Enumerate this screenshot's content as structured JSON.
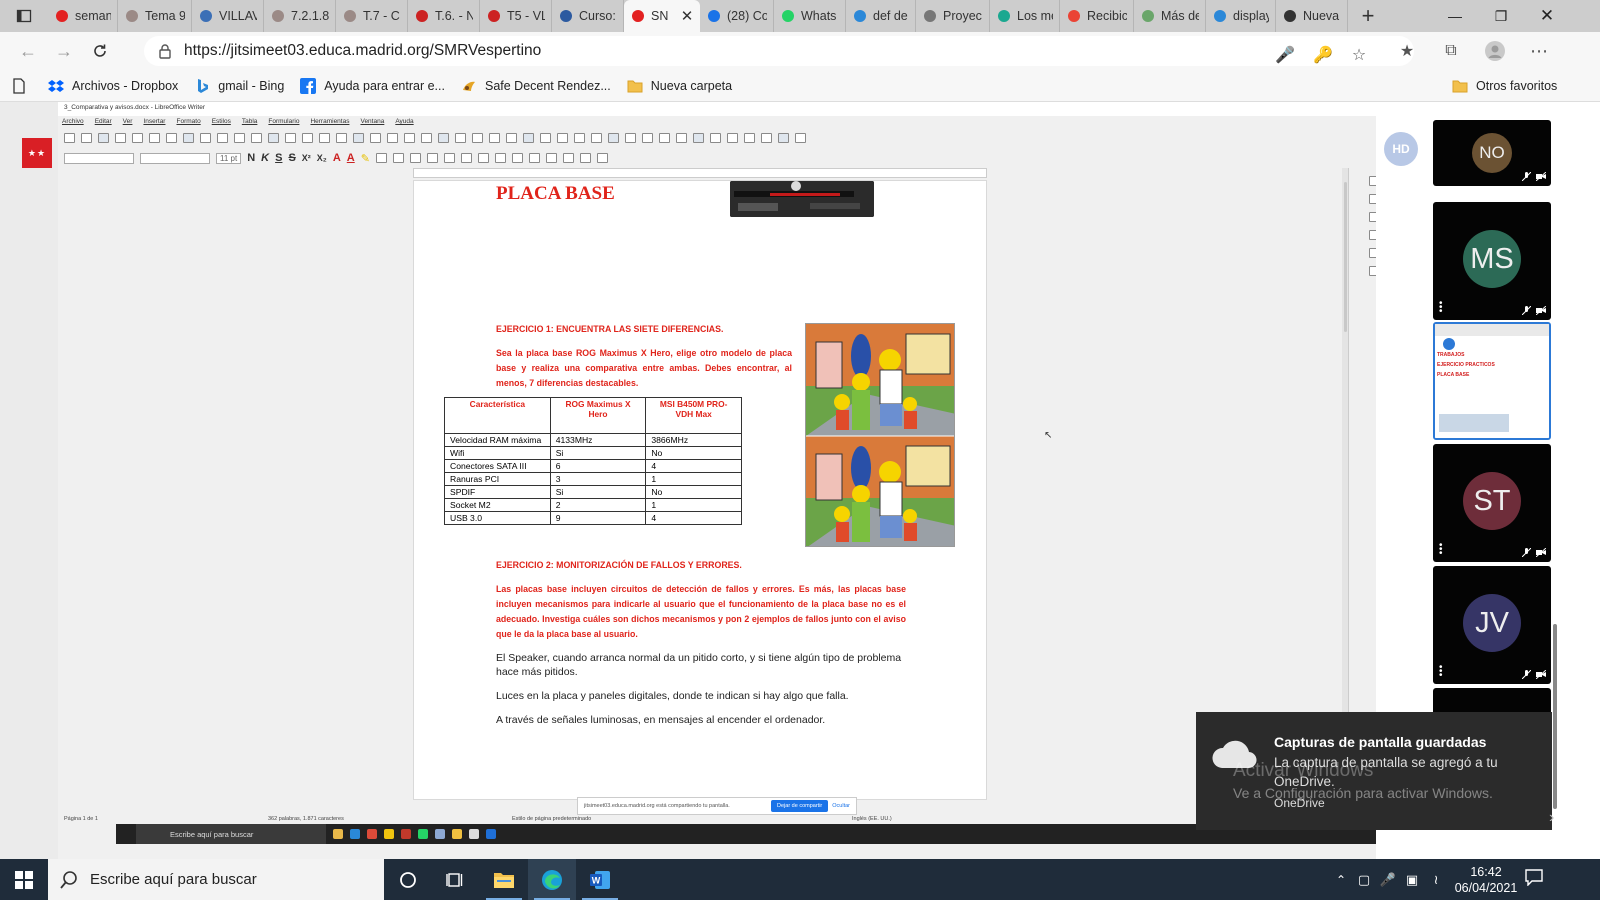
{
  "browser": {
    "tabs": [
      {
        "title": "seman",
        "icon": "youtube-icon",
        "color": "#e32121",
        "w": 70
      },
      {
        "title": "Tema 9",
        "icon": "settings-globe-icon",
        "color": "#9b8a86",
        "w": 74
      },
      {
        "title": "VILLAV",
        "icon": "education-cap-icon",
        "color": "#3b6fb6",
        "w": 72
      },
      {
        "title": "7.2.1.8",
        "icon": "settings-globe-icon",
        "color": "#9b8a86",
        "w": 72
      },
      {
        "title": "T.7 - C",
        "icon": "settings-globe-icon",
        "color": "#9b8a86",
        "w": 72
      },
      {
        "title": "T.6. - N",
        "icon": "globe-red-icon",
        "color": "#c22",
        "w": 72
      },
      {
        "title": "T5 - VL",
        "icon": "globe-red-icon",
        "color": "#c22",
        "w": 72
      },
      {
        "title": "Curso:",
        "icon": "education-cap-icon",
        "color": "#2c5aa0",
        "w": 72
      },
      {
        "title": "SN",
        "icon": "record-icon",
        "color": "#e32121",
        "w": 76,
        "active": true
      },
      {
        "title": "(28) Co",
        "icon": "mail-icon",
        "color": "#1a73e8",
        "w": 74
      },
      {
        "title": "Whats",
        "icon": "whatsapp-icon",
        "color": "#25d366",
        "w": 72
      },
      {
        "title": "def de",
        "icon": "bing-icon",
        "color": "#2b88d8",
        "w": 70
      },
      {
        "title": "Proyec",
        "icon": "image-icon",
        "color": "#777",
        "w": 74
      },
      {
        "title": "Los me",
        "icon": "document-icon",
        "color": "#1ba890",
        "w": 70
      },
      {
        "title": "Recibic",
        "icon": "gmail-icon",
        "color": "#ea4335",
        "w": 74
      },
      {
        "title": "Más de",
        "icon": "page-icon",
        "color": "#6aa66a",
        "w": 72
      },
      {
        "title": "display",
        "icon": "bing-icon",
        "color": "#2b88d8",
        "w": 70
      },
      {
        "title": "Nueva",
        "icon": "newtab-icon",
        "color": "#333",
        "w": 72
      }
    ],
    "url": "https://jitsimeet03.educa.madrid.org/SMRVespertino",
    "bookmarks": [
      {
        "label": "Archivos - Dropbox",
        "icon": "dropbox-icon"
      },
      {
        "label": "gmail - Bing",
        "icon": "bing-icon"
      },
      {
        "label": "Ayuda para entrar e...",
        "icon": "facebook-icon"
      },
      {
        "label": "Safe Decent Rendez...",
        "icon": "bookmark-icon"
      },
      {
        "label": "Nueva carpeta",
        "icon": "folder-icon"
      }
    ],
    "other_favorites": "Otros favoritos"
  },
  "remote": {
    "window_title": "3_Comparativa y avisos.docx - LibreOffice Writer",
    "menu": [
      "Archivo",
      "Editar",
      "Ver",
      "Insertar",
      "Formato",
      "Estilos",
      "Tabla",
      "Formulario",
      "Herramientas",
      "Ventana",
      "Ayuda"
    ],
    "font_size": "11 pt",
    "status": [
      "Página 1 de 1",
      "362 palabras, 1.871 caracteres",
      "Estilo de página predeterminado",
      "Inglés (EE. UU.)"
    ],
    "taskbar_search": "Escribe aquí para buscar",
    "share_text": "jitsimeet03.educa.madrid.org está compartiendo tu pantalla.",
    "share_stop": "Dejar de compartir",
    "share_hide": "Ocultar"
  },
  "doc": {
    "heading": "PLACA BASE",
    "ex1_title": "EJERCICIO 1: ENCUENTRA LAS SIETE DIFERENCIAS.",
    "ex1_text": "Sea la placa base ROG Maximus X Hero, elige otro modelo de placa base y realiza una comparativa entre ambas. Debes encontrar, al menos, 7 diferencias destacables.",
    "table": {
      "headers": [
        "Característica",
        "ROG Maximus X Hero",
        "MSI B450M PRO-VDH Max"
      ],
      "rows": [
        [
          "Velocidad RAM máxima",
          "4133MHz",
          "3866MHz"
        ],
        [
          "Wifi",
          "Si",
          "No"
        ],
        [
          "Conectores SATA III",
          "6",
          "4"
        ],
        [
          "Ranuras PCI",
          "3",
          "1"
        ],
        [
          "SPDIF",
          "Si",
          "No"
        ],
        [
          "Socket M2",
          "2",
          "1"
        ],
        [
          "USB 3.0",
          "9",
          "4"
        ]
      ]
    },
    "ex2_title": "EJERCICIO 2: MONITORIZACIÓN DE FALLOS Y ERRORES.",
    "ex2_text": "Las placas base incluyen circuitos de detección de fallos y errores. Es más, las placas base incluyen mecanismos para indicarle al usuario que el funcionamiento de la placa base no es el adecuado. Investiga cuáles son dichos mecanismos y pon 2 ejemplos de fallos junto con el aviso que le da la placa base al usuario.",
    "answer1": "El Speaker, cuando arranca normal da un pitido corto, y si tiene algún tipo de problema hace más pitidos.",
    "answer2": "Luces en la placa y paneles digitales, donde te indican si hay algo que falla.",
    "answer3": "A través de señales luminosas, en mensajes al encender el ordenador."
  },
  "participants": {
    "self_initials": "HD",
    "tiles": [
      {
        "initials": "NO",
        "color": "#6b5233",
        "type": "avatar",
        "small": true
      },
      {
        "initials": "MS",
        "color": "#2c6a56",
        "type": "avatar"
      },
      {
        "initials": "",
        "type": "screenshare"
      },
      {
        "initials": "ST",
        "color": "#6e2d3a",
        "type": "avatar"
      },
      {
        "initials": "JV",
        "color": "#363566",
        "type": "avatar"
      }
    ],
    "share_thumb_lines": [
      "TRABAJOS",
      "EJERCICIO PRACTICOS",
      "PLACA BASE"
    ]
  },
  "toast": {
    "title": "Capturas de pantalla guardadas",
    "body": "La captura de pantalla se agregó a tu OneDrive.",
    "app": "OneDrive",
    "watermark_title": "Activar Windows",
    "watermark_sub": "Ve a Configuración para activar Windows."
  },
  "taskbar": {
    "search_placeholder": "Escribe aquí para buscar",
    "time": "16:42",
    "date": "06/04/2021"
  }
}
